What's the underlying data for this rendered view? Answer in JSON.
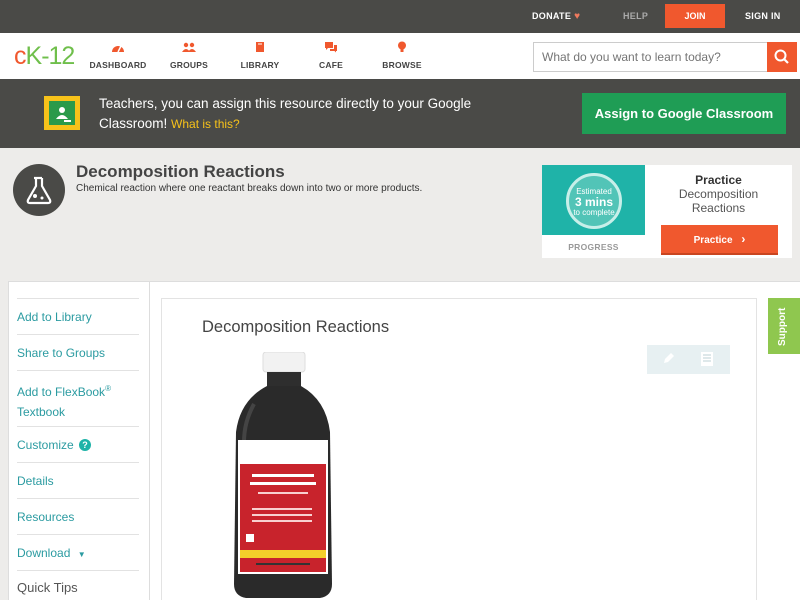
{
  "topbar": {
    "donate": "DONATE",
    "help": "HELP",
    "join": "JOIN",
    "signin": "SIGN IN"
  },
  "logo": {
    "part1": "c",
    "part2": "K",
    "part3": "-12"
  },
  "nav": [
    {
      "label": "DASHBOARD",
      "icon": "dashboard-icon"
    },
    {
      "label": "GROUPS",
      "icon": "groups-icon"
    },
    {
      "label": "LIBRARY",
      "icon": "library-icon"
    },
    {
      "label": "CAFE",
      "icon": "cafe-icon"
    },
    {
      "label": "BROWSE",
      "icon": "browse-icon"
    }
  ],
  "search": {
    "placeholder": "What do you want to learn today?"
  },
  "banner": {
    "text": "Teachers, you can assign this resource directly to your Google Classroom!",
    "link": "What is this?",
    "button": "Assign to Google Classroom"
  },
  "concept": {
    "title": "Decomposition Reactions",
    "description": "Chemical reaction where one reactant breaks down into two or more products."
  },
  "practice": {
    "estimated_line1": "Estimated",
    "estimated_value": "3 mins",
    "estimated_line3": "to complete",
    "progress": "PROGRESS",
    "title": "Practice",
    "subtitle_line1": "Decomposition",
    "subtitle_line2": "Reactions",
    "button": "Practice"
  },
  "sidebar": {
    "add_library": "Add to Library",
    "share_groups": "Share to Groups",
    "flexbook_line1": "Add to FlexBook",
    "flexbook_reg": "®",
    "flexbook_line2": "Textbook",
    "customize": "Customize",
    "customize_help": "?",
    "details": "Details",
    "resources": "Resources",
    "download": "Download",
    "quick_tips": "Quick Tips"
  },
  "content": {
    "title": "Decomposition Reactions"
  },
  "support": "Support",
  "colors": {
    "brand_orange": "#f0582e",
    "brand_green": "#6fbf4b",
    "teal": "#2b9ba1",
    "google_green": "#1f9d55",
    "dark_bar": "#4a4a47"
  }
}
